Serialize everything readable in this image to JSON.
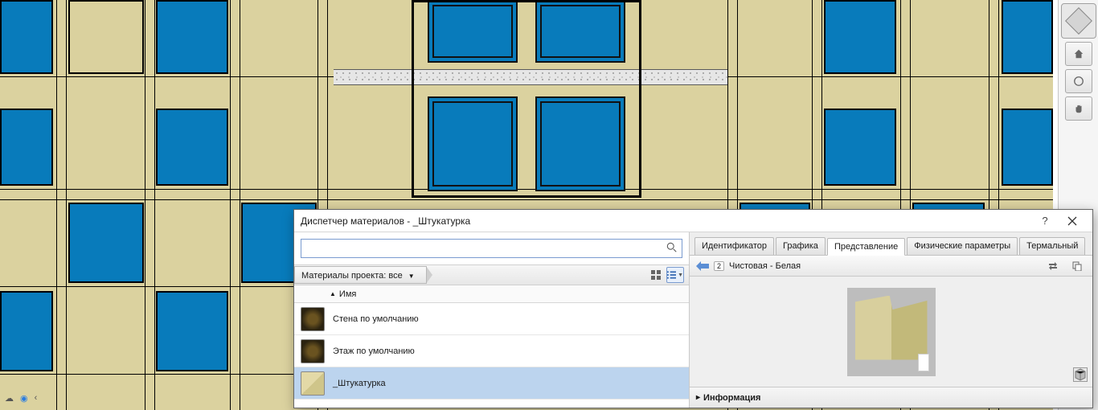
{
  "dialog": {
    "title": "Диспетчер материалов - _Штукатурка",
    "search_placeholder": "",
    "filter_label": "Материалы проекта: все",
    "column_header": "Имя",
    "materials": [
      {
        "name": "Стена по умолчанию"
      },
      {
        "name": "Этаж по умолчанию"
      },
      {
        "name": "_Штукатурка"
      }
    ],
    "tabs": {
      "ident": "Идентификатор",
      "graphic": "Графика",
      "appearance": "Представление",
      "physical": "Физические параметры",
      "thermal": "Термальный"
    },
    "asset_badge": "2",
    "asset_name": "Чистовая - Белая",
    "expander": "Информация"
  }
}
